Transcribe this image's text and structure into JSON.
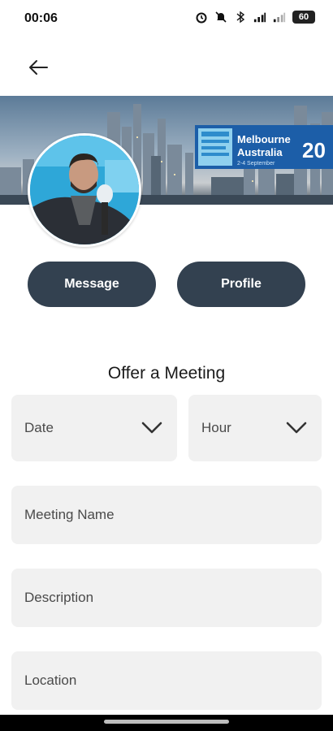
{
  "status_bar": {
    "time": "00:06",
    "battery": "60",
    "icons": [
      "alarm-icon",
      "bell-off-icon",
      "bluetooth-icon",
      "signal-icon",
      "signal-icon-2",
      "battery-icon"
    ]
  },
  "header": {
    "back_icon": "arrow-left-icon"
  },
  "banner": {
    "sign_line1": "Melbourne",
    "sign_line2": "Australia",
    "sign_year": "20",
    "sign_date": "2-4 September"
  },
  "actions": {
    "message_label": "Message",
    "profile_label": "Profile"
  },
  "form": {
    "title": "Offer a Meeting",
    "date_label": "Date",
    "hour_label": "Hour",
    "meeting_name_placeholder": "Meeting Name",
    "description_placeholder": "Description",
    "location_placeholder": "Location"
  },
  "colors": {
    "button_bg": "#334150",
    "field_bg": "#f1f1f1",
    "text": "#1a1a1a"
  }
}
